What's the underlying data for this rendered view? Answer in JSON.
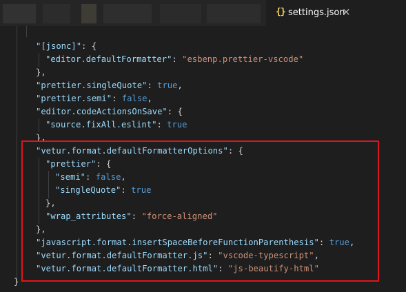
{
  "tab": {
    "icon": "{}",
    "title": "settings.json",
    "close": "×"
  },
  "code": {
    "l1": {
      "key": "\"[jsonc]\"",
      "rest": ": {"
    },
    "l2": {
      "key": "\"editor.defaultFormatter\"",
      "sep": ": ",
      "val": "\"esbenp.prettier-vscode\""
    },
    "l3": {
      "text": "},"
    },
    "l4": {
      "key": "\"prettier.singleQuote\"",
      "sep": ": ",
      "val": "true",
      "end": ","
    },
    "l5": {
      "key": "\"prettier.semi\"",
      "sep": ": ",
      "val": "false",
      "end": ","
    },
    "l6": {
      "key": "\"editor.codeActionsOnSave\"",
      "rest": ": {"
    },
    "l7": {
      "key": "\"source.fixAll.eslint\"",
      "sep": ": ",
      "val": "true"
    },
    "l8": {
      "text": "},"
    },
    "l9": {
      "key": "\"vetur.format.defaultFormatterOptions\"",
      "rest": ": {"
    },
    "l10": {
      "key": "\"prettier\"",
      "rest": ": {"
    },
    "l11": {
      "key": "\"semi\"",
      "sep": ": ",
      "val": "false",
      "end": ","
    },
    "l12": {
      "key": "\"singleQuote\"",
      "sep": ": ",
      "val": "true"
    },
    "l13": {
      "text": "},"
    },
    "l14": {
      "key": "\"wrap_attributes\"",
      "sep": ": ",
      "val": "\"force-aligned\""
    },
    "l15": {
      "text": "},"
    },
    "l16": {
      "key": "\"javascript.format.insertSpaceBeforeFunctionParenthesis\"",
      "sep": ": ",
      "val": "true",
      "end": ","
    },
    "l17": {
      "key": "\"vetur.format.defaultFormatter.js\"",
      "sep": ": ",
      "val": "\"vscode-typescript\"",
      "end": ","
    },
    "l18": {
      "key": "\"vetur.format.defaultFormatter.html\"",
      "sep": ": ",
      "val": "\"js-beautify-html\""
    },
    "l19": {
      "text": "}"
    }
  },
  "colors": {
    "highlight_box": "#e1141c",
    "key": "#9cdcfe",
    "string": "#ce9178",
    "keyword": "#569cd6"
  }
}
